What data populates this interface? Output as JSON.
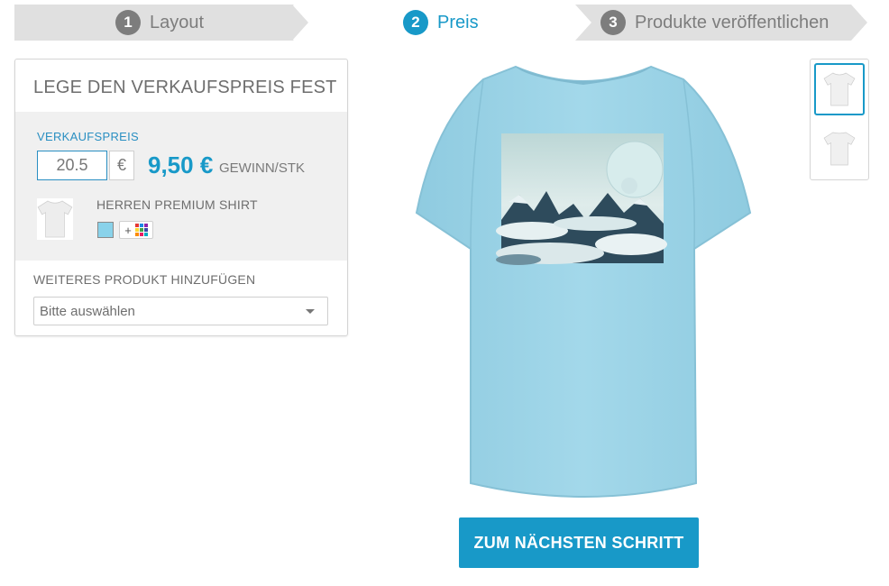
{
  "steps": [
    {
      "number": "1",
      "label": "Layout"
    },
    {
      "number": "2",
      "label": "Preis"
    },
    {
      "number": "3",
      "label": "Produkte veröffentlichen"
    }
  ],
  "panel": {
    "title": "LEGE DEN VERKAUFSPREIS FEST",
    "price_label": "VERKAUFSPREIS",
    "price_value": "20.5",
    "currency": "€",
    "profit_amount": "9,50 €",
    "profit_unit": "GEWINN/STK",
    "product_name": "HERREN PREMIUM SHIRT",
    "selected_color": "#89d2ea",
    "add_color_symbol": "+",
    "add_product_label": "WEITERES PRODUKT HINZUFÜGEN",
    "add_product_placeholder": "Bitte auswählen"
  },
  "preview": {
    "shirt_color": "#9ed4e6",
    "next_button_label": "ZUM NÄCHSTEN SCHRITT"
  },
  "colors": {
    "accent": "#1899c8",
    "inactive_step": "#7d7d7d"
  }
}
